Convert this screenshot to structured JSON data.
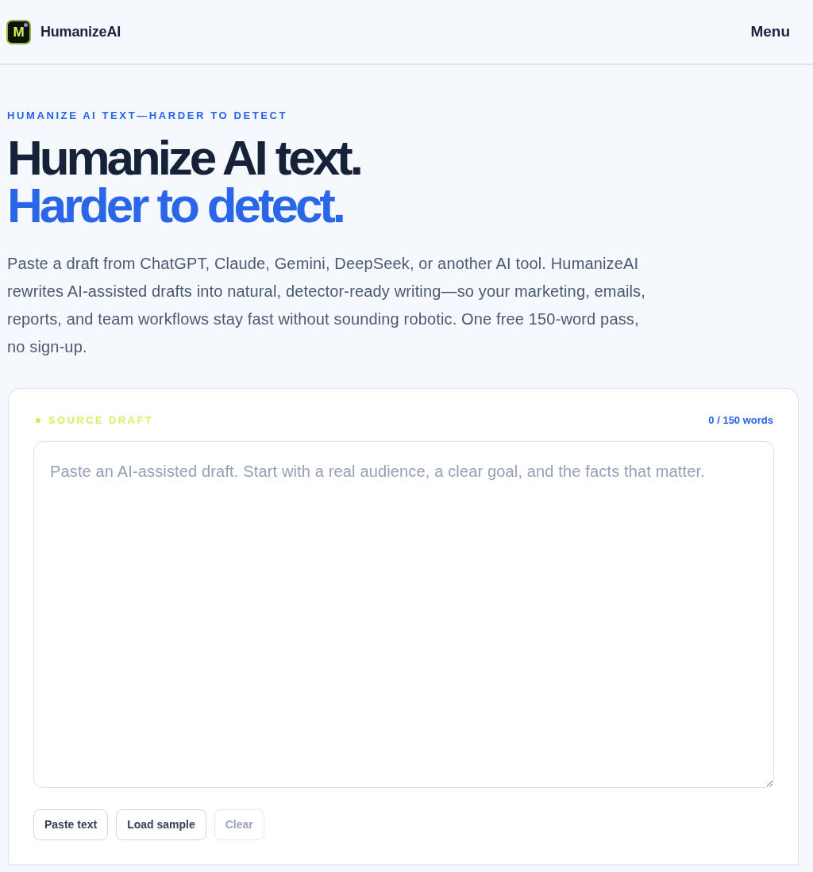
{
  "header": {
    "logo_letter": "M",
    "brand": "HumanizeAI",
    "menu": "Menu"
  },
  "hero": {
    "eyebrow": "HUMANIZE AI TEXT—HARDER TO DETECT",
    "headline": "Humanize AI text.",
    "headline_accent": "Harder to detect.",
    "intro": "Paste a draft from ChatGPT, Claude, Gemini, DeepSeek, or another AI tool. HumanizeAI rewrites AI-assisted drafts into natural, detector-ready writing—so your marketing, emails, reports, and team workflows stay fast without sounding robotic. One free 150-word pass, no sign-up."
  },
  "editor": {
    "label": "SOURCE DRAFT",
    "word_count": "0 / 150 words",
    "placeholder": "Paste an AI-assisted draft. Start with a real audience, a clear goal, and the facts that matter.",
    "buttons": [
      {
        "label": "Paste text",
        "disabled": false
      },
      {
        "label": "Load sample",
        "disabled": false
      },
      {
        "label": "Clear",
        "disabled": true
      }
    ]
  }
}
